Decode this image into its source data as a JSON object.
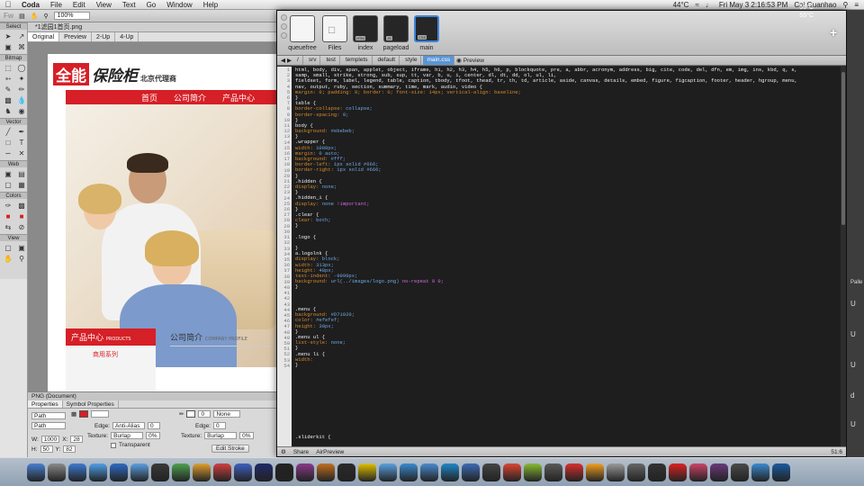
{
  "menubar": {
    "app": "Coda",
    "items": [
      "File",
      "Edit",
      "View",
      "Text",
      "Go",
      "Window",
      "Help"
    ],
    "temp": "44°C",
    "clock": "Fri May 3  2:16:53 PM",
    "user": "Cai Guanhao"
  },
  "fireworks": {
    "zoom": "100%",
    "doc_tab": "*1滤园1首页.png",
    "view_tabs": [
      "Original",
      "Preview",
      "2-Up",
      "4-Up"
    ],
    "tool_sections": [
      "Select",
      "Bitmap",
      "Vector",
      "Web",
      "Colors",
      "View"
    ],
    "site": {
      "logo_a": "全能",
      "logo_b": "保险柜",
      "logo_c": "北京代理商",
      "nav": [
        "首页",
        "公司简介",
        "产品中心"
      ],
      "products_heading": "产品中心",
      "products_sub": "PRODUCTS",
      "products_item": "商用系列",
      "about_heading": "公司简介",
      "about_sub": "COMPANY PROFILE"
    },
    "properties": {
      "title": "PNG (Document)",
      "tabs": [
        "Properties",
        "Symbol Properties"
      ],
      "object": "Path",
      "object2": "Path",
      "edge_label": "Edge:",
      "edge_value": "Anti-Alias",
      "texture_label": "Texture:",
      "texture_value": "Burlap",
      "texture_pct": "0%",
      "transparent": "Transparent",
      "edge2_value": "0",
      "texture2_value": "Burlap",
      "texture2_pct": "0%",
      "stroke_val": "0",
      "stroke_style": "None",
      "edit_stroke": "Edit Stroke",
      "w_label": "W:",
      "w": "1000",
      "x_label": "X:",
      "x": "28",
      "h_label": "H:",
      "h": "50",
      "y_label": "Y:",
      "y": "82"
    }
  },
  "coda": {
    "thumbs": [
      {
        "label": "queuefree",
        "style": "light"
      },
      {
        "label": "Files",
        "style": "light"
      },
      {
        "label": "index",
        "style": "dark",
        "tag": "HTM"
      },
      {
        "label": "pageload",
        "style": "dark",
        "tag": "JS"
      },
      {
        "label": "main",
        "style": "dark",
        "tag": "CSS"
      }
    ],
    "path": [
      "/",
      "srv",
      "test",
      "templets",
      "default",
      "style",
      "main.css",
      "Preview"
    ],
    "status_share": "Share",
    "status_preview": "AirPreview",
    "status_pos": "51:6",
    "code": [
      [
        [
          "sel",
          "html, body, div, span, applet, object, iframe, h1, h2, h3, h4, h5, h6, p, blockquote, pre, a, abbr, acronym, address, big, cite, code, del, dfn, em, img, ins, kbd, q, s,"
        ]
      ],
      [
        [
          "sel",
          "samp, small, strike, strong, sub, sup, tt, var, b, u, i, center, dl, dt, dd, ol, ul, li,"
        ]
      ],
      [
        [
          "sel",
          "fieldset, form, label, legend, table, caption, tbody, tfoot, thead, tr, th, td, article, aside, canvas, details, embed, figure, figcaption, footer, header, hgroup, menu,"
        ]
      ],
      [
        [
          "sel",
          "nav, output, ruby, section, summary, time, mark, audio, video {"
        ]
      ],
      [
        [
          "prop",
          "margin: 0; padding: 0; border: 0; font-size: 14px; vertical-align: baseline;"
        ]
      ],
      [
        [
          "pl",
          "}"
        ]
      ],
      [
        [
          "sel",
          "table {"
        ]
      ],
      [
        [
          "prop",
          "border-collapse: "
        ],
        [
          "val",
          "collapse;"
        ]
      ],
      [
        [
          "prop",
          "border-spacing: "
        ],
        [
          "val",
          "0;"
        ]
      ],
      [
        [
          "pl",
          "}"
        ]
      ],
      [
        [
          "sel",
          "body {"
        ]
      ],
      [
        [
          "prop",
          "background: "
        ],
        [
          "val",
          "#ebebeb;"
        ]
      ],
      [
        [
          "pl",
          "}"
        ]
      ],
      [
        [
          "sel",
          ".wrapper {"
        ]
      ],
      [
        [
          "prop",
          "width: "
        ],
        [
          "val",
          "1000px;"
        ]
      ],
      [
        [
          "prop",
          "margin: "
        ],
        [
          "val",
          "0 auto;"
        ]
      ],
      [
        [
          "prop",
          "background: "
        ],
        [
          "val",
          "#fff;"
        ]
      ],
      [
        [
          "prop",
          "border-left: "
        ],
        [
          "val",
          "1px solid #666;"
        ]
      ],
      [
        [
          "prop",
          "border-right: "
        ],
        [
          "val",
          "1px solid #666;"
        ]
      ],
      [
        [
          "pl",
          "}"
        ]
      ],
      [
        [
          "sel",
          ".hidden {"
        ]
      ],
      [
        [
          "prop",
          "display: "
        ],
        [
          "val",
          "none;"
        ]
      ],
      [
        [
          "pl",
          "}"
        ]
      ],
      [
        [
          "sel",
          ".hidden_i {"
        ]
      ],
      [
        [
          "prop",
          "display: "
        ],
        [
          "val",
          "none "
        ],
        [
          "kw",
          "!important;"
        ]
      ],
      [
        [
          "pl",
          "}"
        ]
      ],
      [
        [
          "sel",
          ".clear {"
        ]
      ],
      [
        [
          "prop",
          "clear: "
        ],
        [
          "val",
          "both;"
        ]
      ],
      [
        [
          "pl",
          "}"
        ]
      ],
      [
        [
          "pl",
          ""
        ]
      ],
      [
        [
          "sel",
          ".logo {"
        ]
      ],
      [
        [
          "pl",
          ""
        ]
      ],
      [
        [
          "pl",
          "}"
        ]
      ],
      [
        [
          "sel",
          "a.logolnk {"
        ]
      ],
      [
        [
          "prop",
          "display: "
        ],
        [
          "val",
          "block;"
        ]
      ],
      [
        [
          "prop",
          "width: "
        ],
        [
          "val",
          "313px;"
        ]
      ],
      [
        [
          "prop",
          "height: "
        ],
        [
          "val",
          "48px;"
        ]
      ],
      [
        [
          "prop",
          "text-indent: "
        ],
        [
          "val",
          "-9999px;"
        ]
      ],
      [
        [
          "prop",
          "background: "
        ],
        [
          "val",
          "url(../images/logo.png) "
        ],
        [
          "kw",
          "no-repeat 0 0;"
        ]
      ],
      [
        [
          "pl",
          "}"
        ]
      ],
      [
        [
          "pl",
          ""
        ]
      ],
      [
        [
          "pl",
          ""
        ]
      ],
      [
        [
          "pl",
          ""
        ]
      ],
      [
        [
          "sel",
          ".menu {"
        ]
      ],
      [
        [
          "prop",
          "background: "
        ],
        [
          "val",
          "#D71920;"
        ]
      ],
      [
        [
          "prop",
          "color: "
        ],
        [
          "val",
          "#efefef;"
        ]
      ],
      [
        [
          "prop",
          "height: "
        ],
        [
          "val",
          "30px;"
        ]
      ],
      [
        [
          "pl",
          "}"
        ]
      ],
      [
        [
          "sel",
          ".menu ul {"
        ]
      ],
      [
        [
          "prop",
          "list-style: "
        ],
        [
          "val",
          "none;"
        ]
      ],
      [
        [
          "pl",
          "}"
        ]
      ],
      [
        [
          "sel",
          ".menu li {"
        ]
      ],
      [
        [
          "prop",
          "width:"
        ]
      ],
      [
        [
          "pl",
          "}"
        ]
      ]
    ],
    "last_line": ".sliderkit {"
  },
  "rightedge": [
    "Palle",
    "U",
    "U",
    "U",
    "d",
    "U"
  ],
  "weather": {
    "t1": "56°C",
    "t2": "55°C"
  },
  "dock_colors": [
    "#4a7fd0",
    "#8a8a8a",
    "#3c7bd0",
    "#4fa0e8",
    "#2e6bc5",
    "#5aa0e0",
    "#3a3a3a",
    "#50a050",
    "#e0a030",
    "#d04040",
    "#4060c0",
    "#202a6a",
    "#222",
    "#8a3a8a",
    "#c07020",
    "#2a2a2a",
    "#e0c000",
    "#5aa0e0",
    "#3a8ad0",
    "#4a8ad0",
    "#1e88c8",
    "#3d6bb5",
    "#444",
    "#dd4433",
    "#88bb33",
    "#5a5a5a",
    "#d83030",
    "#f0a020",
    "#9a9a9a",
    "#666",
    "#333",
    "#dd2222",
    "#cc4466",
    "#6a3a7a",
    "#4a4a4a",
    "#3a8ad0",
    "#1a5aa0"
  ]
}
